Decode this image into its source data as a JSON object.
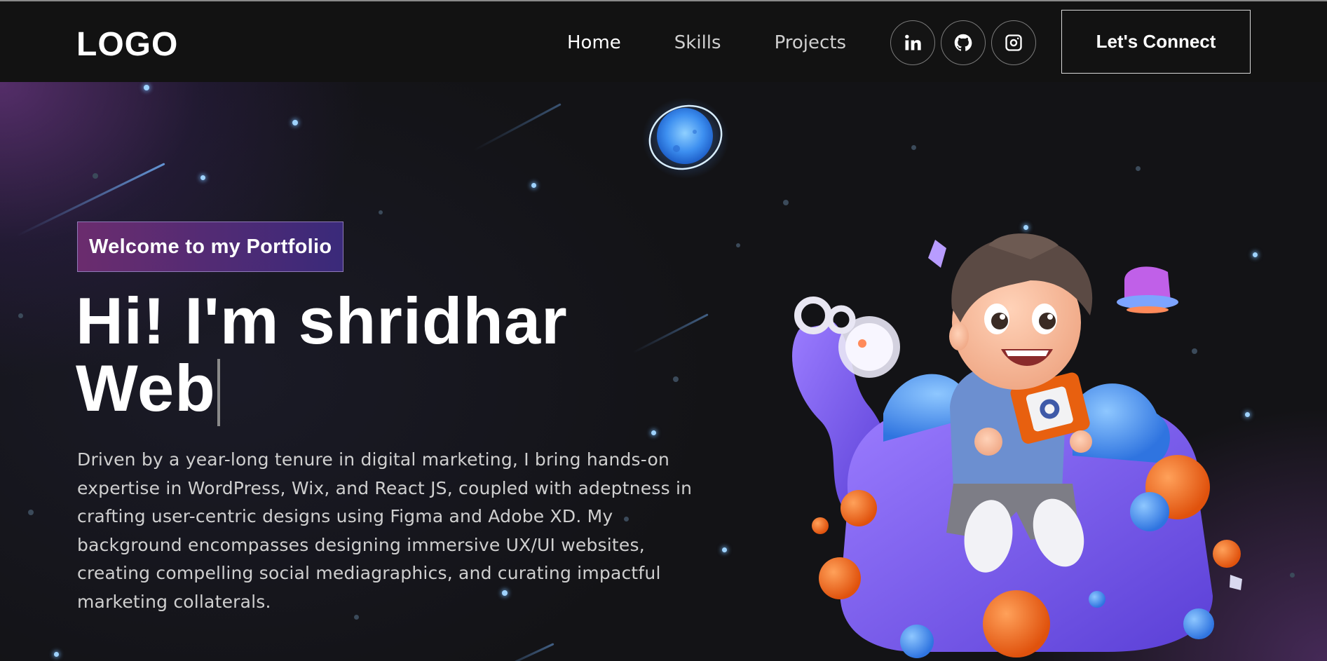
{
  "navbar": {
    "logo": "LOGO",
    "links": [
      {
        "label": "Home"
      },
      {
        "label": "Skills"
      },
      {
        "label": "Projects"
      }
    ],
    "socials": [
      {
        "icon": "linkedin-icon"
      },
      {
        "icon": "github-icon"
      },
      {
        "icon": "instagram-icon"
      }
    ],
    "cta_label": "Let's Connect"
  },
  "hero": {
    "badge": "Welcome to my Portfolio",
    "headline_line1": "Hi! I'm shridhar",
    "headline_line2": "Web",
    "description": "Driven by a year-long tenure in digital marketing, I bring hands-on expertise in WordPress, Wix, and React JS, coupled with adeptness in crafting user-centric designs using Figma and Adobe XD. My background encompasses designing immersive UX/UI websites, creating compelling social mediagraphics, and curating impactful marketing collaterals.",
    "illustration": "3d-boy-on-purple-chair-illustration"
  },
  "colors": {
    "background": "#121212",
    "badge_from": "#6b2c6e",
    "badge_to": "#3a2a7a",
    "accent_blue": "#5aa8ff",
    "accent_purple": "#7a5cf0"
  }
}
